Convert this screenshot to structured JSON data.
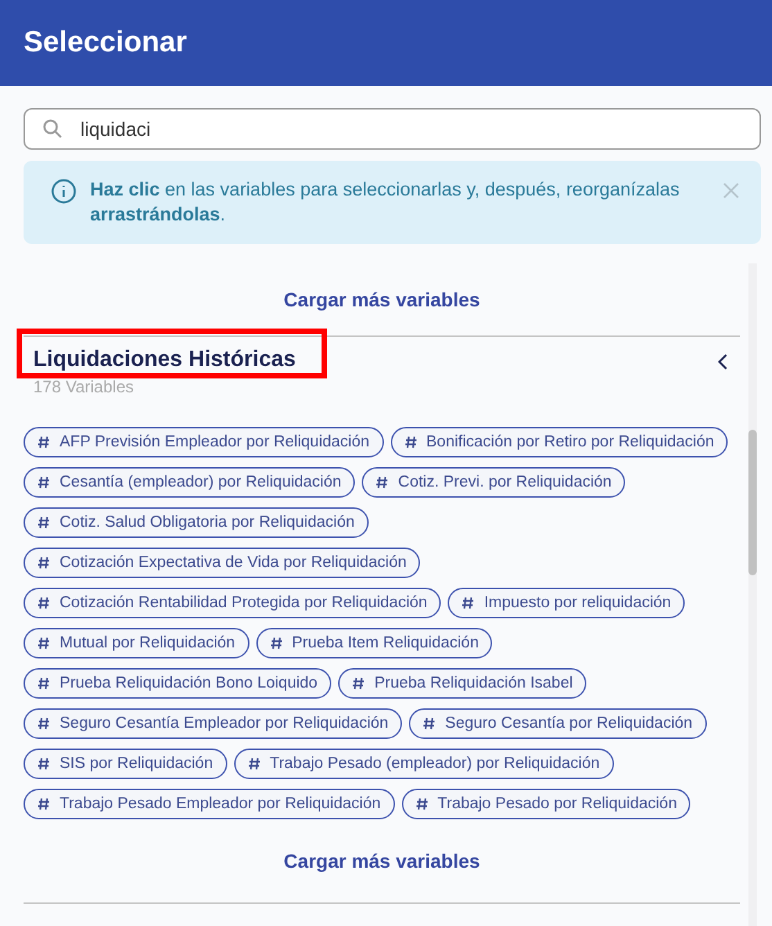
{
  "dialog": {
    "title": "Seleccionar"
  },
  "search": {
    "value": "liquidaci"
  },
  "info": {
    "text": "**Haz clic** en las variables para seleccionarlas y, después, reorganízalas **arrastrándolas**."
  },
  "load_more_top": "Cargar más variables",
  "group": {
    "title": "Liquidaciones Históricas",
    "subtitle": "178 Variables",
    "expanded": true,
    "highlighted": true,
    "variables": [
      "AFP Previsión Empleador por Reliquidación",
      "Bonificación por Retiro por Reliquidación",
      "Cesantía (empleador) por Reliquidación",
      "Cotiz. Previ. por Reliquidación",
      "Cotiz. Salud Obligatoria por Reliquidación",
      "Cotización Expectativa de Vida por Reliquidación",
      "Cotización Rentabilidad Protegida por Reliquidación",
      "Impuesto por reliquidación",
      "Mutual por Reliquidación",
      "Prueba Item Reliquidación",
      "Prueba Reliquidación Bono Loiquido",
      "Prueba Reliquidación Isabel",
      "Seguro Cesantía Empleador por Reliquidación",
      "Seguro Cesantía por Reliquidación",
      "SIS por Reliquidación",
      "Trabajo Pesado (empleador) por Reliquidación",
      "Trabajo Pesado Empleador por Reliquidación",
      "Trabajo Pesado por Reliquidación"
    ]
  },
  "load_more_bottom": "Cargar más variables"
}
